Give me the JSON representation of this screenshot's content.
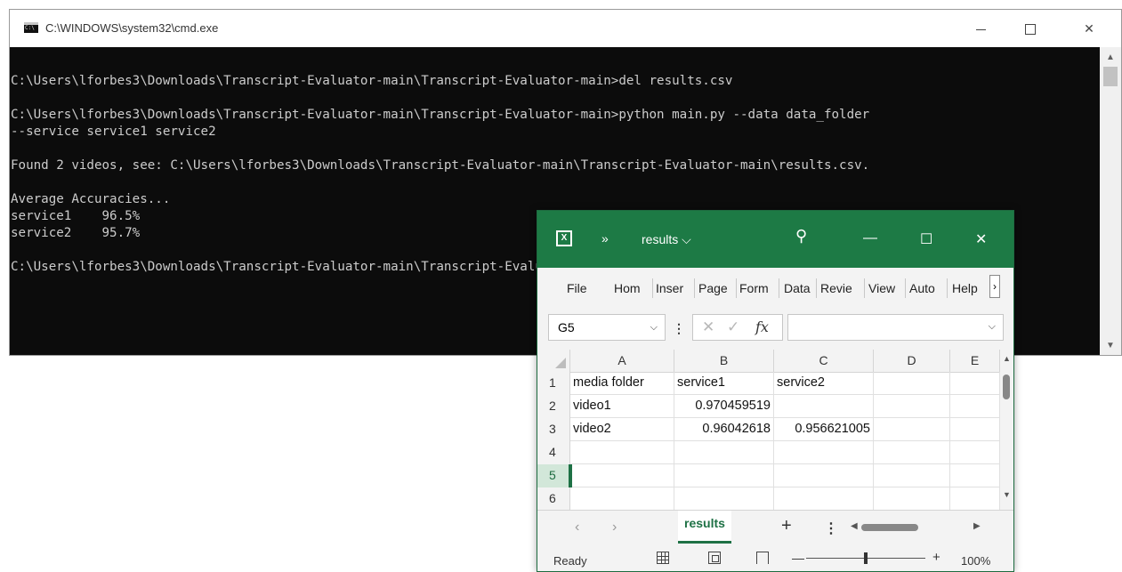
{
  "cmd": {
    "title": "C:\\WINDOWS\\system32\\cmd.exe",
    "icon_text": "C:\\",
    "lines": [
      "C:\\Users\\lforbes3\\Downloads\\Transcript-Evaluator-main\\Transcript-Evaluator-main>del results.csv",
      "",
      "C:\\Users\\lforbes3\\Downloads\\Transcript-Evaluator-main\\Transcript-Evaluator-main>python main.py --data data_folder",
      "--service service1 service2",
      "",
      "Found 2 videos, see: C:\\Users\\lforbes3\\Downloads\\Transcript-Evaluator-main\\Transcript-Evaluator-main\\results.csv.",
      "",
      "Average Accuracies...",
      "service1    96.5%",
      "service2    95.7%",
      "",
      "C:\\Users\\lforbes3\\Downloads\\Transcript-Evaluator-main\\Transcript-Evaluator-main>"
    ],
    "controls": {
      "close": "✕"
    }
  },
  "excel": {
    "title": "results ⌵",
    "more": "»",
    "search": "⚲",
    "controls": {
      "minimize": "—",
      "maximize": "☐",
      "close": "✕"
    },
    "ribbon_tabs": [
      "File",
      "Hom",
      "Inser",
      "Page",
      "Form",
      "Data",
      "Revie",
      "View",
      "Auto",
      "Help"
    ],
    "ribbon_more": "›",
    "name_box": "G5",
    "name_box_arrow": "⌵",
    "formula_colon": "⋮",
    "formula_icons": {
      "cancel": "✕",
      "enter": "✓",
      "fx": "fx"
    },
    "formula_arrow": "⌵",
    "columns": [
      "A",
      "B",
      "C",
      "D",
      "E"
    ],
    "rows": [
      {
        "num": "1",
        "cells": [
          "media folder",
          "service1",
          "service2",
          "",
          ""
        ]
      },
      {
        "num": "2",
        "cells": [
          "video1",
          "0.970459519",
          "",
          "",
          ""
        ]
      },
      {
        "num": "3",
        "cells": [
          "video2",
          "0.96042618",
          "0.956621005",
          "",
          ""
        ]
      },
      {
        "num": "4",
        "cells": [
          "",
          "",
          "",
          "",
          ""
        ]
      },
      {
        "num": "5",
        "cells": [
          "",
          "",
          "",
          "",
          ""
        ]
      },
      {
        "num": "6",
        "cells": [
          "",
          "",
          "",
          "",
          ""
        ]
      }
    ],
    "numeric_cells": [
      [
        1,
        1
      ],
      [
        2,
        1
      ],
      [
        2,
        2
      ]
    ],
    "selected_row": "5",
    "sheet_nav": {
      "prev": "‹",
      "next": "›"
    },
    "sheet_tab": "results",
    "add_sheet": "+",
    "sheet_menu": "⋮",
    "status": "Ready",
    "zoom": {
      "minus": "—",
      "plus": "+",
      "level": "100%",
      "fraction": 0.5
    },
    "accent": "#1d7a45"
  }
}
